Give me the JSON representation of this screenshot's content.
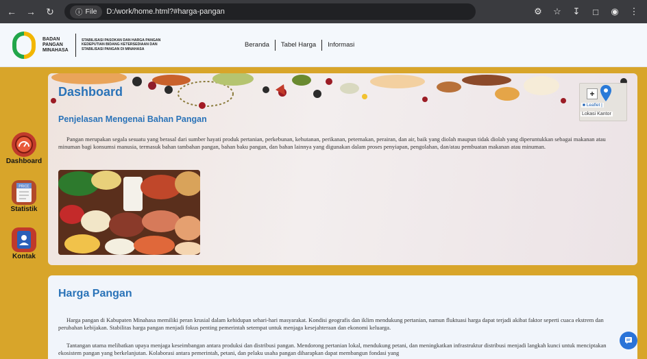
{
  "browser": {
    "chip_label": "File",
    "url": "D:/work/home.html?#harga-pangan",
    "icons": [
      "back-icon",
      "forward-icon",
      "reload-icon",
      "translate-icon",
      "bookmark-star-icon",
      "download-icon",
      "sidebar-icon",
      "profile-icon",
      "more-icon"
    ]
  },
  "header": {
    "brand_lines": [
      "BADAN",
      "PANGAN",
      "MINAHASA"
    ],
    "tagline_lines": [
      "STABILISASI PASOKAN DAN HARGA PANGAN",
      "KEDEPUTIAN BIDANG KETERSEDIAAN DAN",
      "STABILISASI PANGAN DI MINAHASA"
    ],
    "menu": [
      "Beranda",
      "Tabel Harga",
      "Informasi"
    ]
  },
  "sidebar": {
    "items": [
      {
        "label": "Dashboard",
        "icon": "gauge-icon"
      },
      {
        "label": "Statistik",
        "icon": "price-tag-icon"
      },
      {
        "label": "Kontak",
        "icon": "contact-book-icon"
      }
    ],
    "price_tag_text": "PRICE"
  },
  "dashboard": {
    "title": "Dashboard",
    "subtitle": "Penjelasan Mengenai Bahan Pangan",
    "paragraph": "Pangan merupakan segala sesuatu yang berasal dari sumber hayati produk pertanian, perkebunan, kehutanan, perikanan, peternakan, perairan, dan air, baik yang diolah maupun tidak diolah yang diperuntukkan sebagai makanan atau minuman bagi konsumsi manusia, termasuk bahan tambahan pangan, bahan baku pangan, dan bahan lainnya yang digunakan dalam proses penyiapan, pengolahan, dan/atau pembuatan makanan atau minuman."
  },
  "map": {
    "zoom_in": "+",
    "attribution": "Leaflet |",
    "popup": "Lokasi Kantor"
  },
  "harga": {
    "title": "Harga Pangan",
    "paragraphs": [
      "Harga pangan di Kabupaten Minahasa memiliki peran krusial dalam kehidupan sehari-hari masyarakat. Kondisi geografis dan iklim mendukung pertanian, namun fluktuasi harga dapat terjadi akibat faktor seperti cuaca ekstrem dan perubahan kebijakan. Stabilitas harga pangan menjadi fokus penting pemerintah setempat untuk menjaga kesejahteraan dan ekonomi keluarga.",
      "Tantangan utama melibatkan upaya menjaga keseimbangan antara produksi dan distribusi pangan. Mendorong pertanian lokal, mendukung petani, dan meningkatkan infrastruktur distribusi menjadi langkah kunci untuk menciptakan ekosistem pangan yang berkelanjutan. Kolaborasi antara pemerintah, petani, dan pelaku usaha pangan diharapkan dapat membangun fondasi yang"
    ]
  },
  "colors": {
    "page_bg": "#d8a52a",
    "accent_blue": "#2a73b8",
    "logo_green": "#22a64a",
    "logo_yellow": "#f2b600"
  }
}
